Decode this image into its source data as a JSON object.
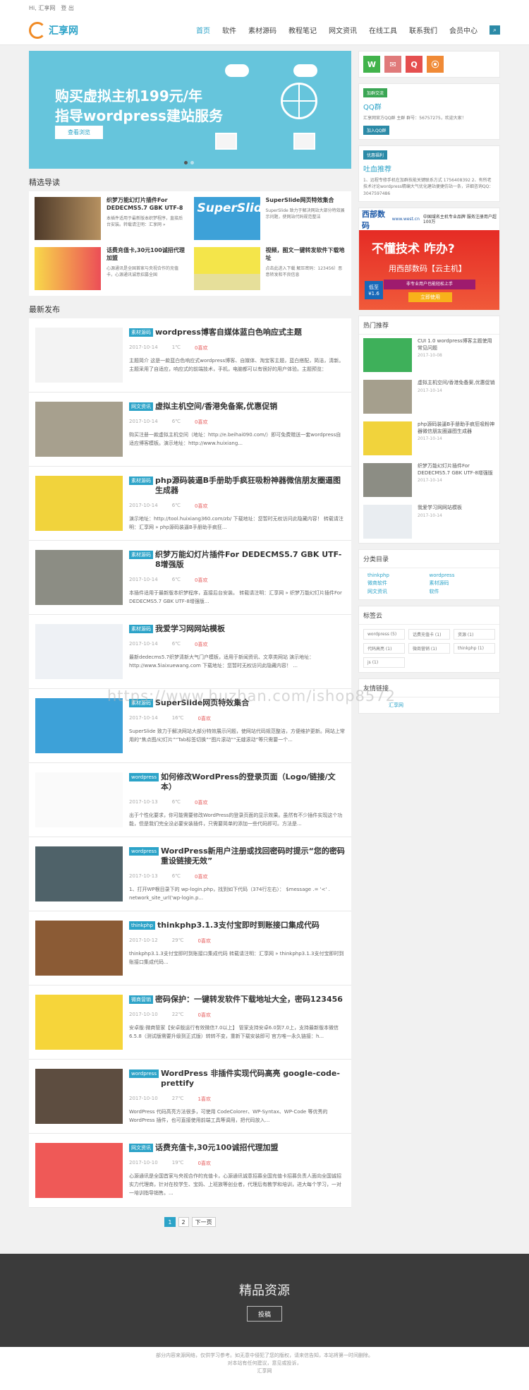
{
  "top": {
    "hi": "Hi, 汇享网",
    "logout": "登 出"
  },
  "brand": {
    "name": "汇享网"
  },
  "nav": [
    "首页",
    "软件",
    "素材源码",
    "教程笔记",
    "网文资讯",
    "在线工具",
    "联系我们",
    "会员中心"
  ],
  "banner": {
    "line1": "购买虚拟主机199元/年",
    "line2": "指导wordpress建站服务",
    "button": "查看浏览"
  },
  "sections": {
    "featured": "精选导读",
    "latest": "最新发布",
    "hot": "热门推荐",
    "cats": "分类目录",
    "tags": "标签云",
    "links": "友情链接"
  },
  "featured": [
    {
      "title": "织梦万能幻灯片插件For DEDECMS5.7 GBK UTF-8",
      "desc": "本插件适用于最新版本织梦程序，直接后台安装。转载请注明：汇享网 »"
    },
    {
      "title": "SuperSlide网页特效集合",
      "desc": "SuperSlide 致力于解决网站大部分特效展示问题，使网站代码规范整洁"
    },
    {
      "title": "话费充值卡,30元100诚招代理加盟",
      "desc": "心源通讯是全国首家与央视合作的充值卡，心源通讯诚意招募全国"
    },
    {
      "title": "视频，图文一键转发软件下载地址",
      "desc": "点击此进入下载 解压密码：123456）恶意转发和不良信息"
    }
  ],
  "posts": [
    {
      "tag": "素材源码",
      "title": "wordpress博客自媒体蓝白色响应式主题",
      "date": "2017-10-14",
      "views": "1℃",
      "likes": "0喜欢",
      "excerpt": "主题简介 这是一款蓝白色响应式wordpress博客、自媒体、淘宝客主题，蓝白搭配，简洁，清新。主题采用了自适应，响应式的前端技术，手机，电脑都可以有很好的用户体验。主题预览："
    },
    {
      "tag": "网文资讯",
      "title": "虚拟主机空间/香港免备案,优惠促销",
      "date": "2017-10-14",
      "views": "6℃",
      "likes": "0喜欢",
      "excerpt": "购买注册一款虚拟主机空间（地址：http://e.beihai090.com/）即可免费赠送一套wordpress自适应博客模板。演示地址：http://www.huixiang..."
    },
    {
      "tag": "素材源码",
      "title": "php源码装逼B手册助手疯狂吸粉神器微信朋友圈逼图生成器",
      "date": "2017-10-14",
      "views": "6℃",
      "likes": "0喜欢",
      "excerpt": "演示地址：http://tool.huixiang360.com/zb/ 下载地址：您暂时无权访问此隐藏内容！ 转载请注明：汇享网 » php源码装逼B手册助手疯狂..."
    },
    {
      "tag": "素材源码",
      "title": "织梦万能幻灯片插件For DEDECMS5.7 GBK UTF-8增强版",
      "date": "2017-10-14",
      "views": "6℃",
      "likes": "0喜欢",
      "excerpt": "本插件适用于最新版本织梦程序，直接后台安装。 转载请注明：汇享网 » 织梦万能幻灯片插件For DEDECMS5.7 GBK UTF-8增强版..."
    },
    {
      "tag": "素材源码",
      "title": "我爱学习网网站模板",
      "date": "2017-10-14",
      "views": "6℃",
      "likes": "0喜欢",
      "excerpt": "最新dedecms5.7织梦清新大气门户模板，适用于新闻资讯、文章类网站 演示地址：http://www.5iaixuewang.com 下载地址：您暂时无权访问此隐藏内容！ ..."
    },
    {
      "tag": "素材源码",
      "title": "SuperSlide网页特效集合",
      "date": "2017-10-14",
      "views": "16℃",
      "likes": "0喜欢",
      "excerpt": "SuperSlide 致力于解决网站大部分特效展示问题，使网站代码规范整洁，方便维护更新。网站上常用的“焦点图/幻灯片”“Tab标签切换”“图片滚动”“无缝滚动”等只需要一个..."
    },
    {
      "tag": "wordpress",
      "title": "如何修改WordPress的登录页面（Logo/链接/文本）",
      "date": "2017-10-13",
      "views": "6℃",
      "likes": "0喜欢",
      "excerpt": "出于个性化要求，你可能需要修改WordPress的登录页面的显示效果。虽然有不少插件实现这个功能，但是我们完全没必要安装插件，只需要简单的添加一些代码即可。方法是..."
    },
    {
      "tag": "wordpress",
      "title": "WordPress新用户注册或找回密码时提示“您的密码重设链接无效”",
      "date": "2017-10-13",
      "views": "6℃",
      "likes": "0喜欢",
      "excerpt": "1、打开WP根目录下的 wp-login.php，找到如下代码（374行左右）： $message .= '<' . network_site_url('wp-login.p..."
    },
    {
      "tag": "thinkphp",
      "title": "thinkphp3.1.3支付宝即时到账接口集成代码",
      "date": "2017-10-12",
      "views": "29℃",
      "likes": "0喜欢",
      "excerpt": "thinkphp3.1.3支付宝即时到账接口集成代码 转载请注明：汇享网 » thinkphp3.1.3支付宝即时到账接口集成代码..."
    },
    {
      "tag": "微商营销",
      "title": "密码保护：一键转发软件下载地址大全，密码123456",
      "date": "2017-10-10",
      "views": "22℃",
      "likes": "0喜欢",
      "excerpt": "安卓版:微商管家【安卓版运行有效微信7.0以上】 管家支持安卓6.0到7.0上，支持最新版本微信6.5.8（测试版需要升级到正式版）转转不变，重新下载安装即可 官方唯一永久链接：h..."
    },
    {
      "tag": "wordpress",
      "title": "WordPress 非插件实现代码高亮 google-code-prettify",
      "date": "2017-10-10",
      "views": "27℃",
      "likes": "1喜欢",
      "excerpt": "WordPress 代码高亮方法很多，可使用 CodeColorer、WP-Syntax、WP-Code 等优秀的 WordPress 插件，也可直接使用前端工具等调用，把代码放入..."
    },
    {
      "tag": "网文资讯",
      "title": "话费充值卡,30元100诚招代理加盟",
      "date": "2017-10-10",
      "views": "19℃",
      "likes": "0喜欢",
      "excerpt": "心源通讯是全国首家与央视合作的充值卡，心源通讯诚意招募全国充值卡招募负责人面向全国诚招实力代理商，针对在校学生、宝妈、上班族等创业者，代理后有教学和培训，进大每个学习，一对一培训指导销售。..."
    }
  ],
  "pager": [
    "1",
    "2",
    "下一页"
  ],
  "side": {
    "qq_badge": "加群交流",
    "qq_title": "QQ群",
    "qq_text": "汇享网官方QQ群 主群 群号：56757275，欢迎大家！",
    "qq_btn": "加入QQ群",
    "tucao_badge": "优惠福利",
    "tucao_title": "吐血推荐",
    "tucao_text": "1、远程专修手机在加群技能关键联系方式 1756408392  2、有所老技术讨论wordpress精编大气优化建站便捷仿站一条，详细咨询QQ：3047597486",
    "ad_logo": "西部数码",
    "ad_site": "www.west.cn",
    "ad_slogan": "中国域名主机专业品牌 服务注册用户超100万",
    "ad_h": "不懂技术 咋办?",
    "ad_s": "用西部数码【云主机】",
    "ad_bar": "非专业用户也能轻松上手",
    "ad_btn": "立即使用",
    "ad_price": "低至 ¥1.6",
    "hot": [
      {
        "title": "CUI 1.0 wordpress博客主题使用常见问题",
        "date": "2017-10-08"
      },
      {
        "title": "虚拟主机空间/香港免备案,优惠促销",
        "date": "2017-10-14"
      },
      {
        "title": "php源码装逼B手册助手疯狂吸粉神器微信朋友圈逼图生成器",
        "date": "2017-10-14"
      },
      {
        "title": "织梦万能幻灯片插件For DEDECMS5.7 GBK UTF-8增强版",
        "date": "2017-10-14"
      },
      {
        "title": "我爱学习网网站模板",
        "date": "2017-10-14"
      }
    ],
    "cats": [
      "thinkphp",
      "wordpress",
      "微商软件",
      "素材源码",
      "网文资讯",
      "软件"
    ],
    "tags": [
      "wordpress (5)",
      "话费充值卡 (1)",
      "资源 (1)",
      "代码高亮 (1)",
      "微商营销 (1)",
      "thinkphp (1)",
      "js (1)"
    ],
    "link": "汇享网"
  },
  "footer": {
    "heading": "精品资源",
    "btn": "投稿",
    "note1": "部分内容来源网络，仅供学习参考。如无意中侵犯了您的版权，请来信告知，本站将第一时间删除。",
    "note2": "对本站有任何建议，意见或投诉，",
    "brand": "汇享网"
  },
  "watermark": "https://www.huzhan.com/ishop8572"
}
